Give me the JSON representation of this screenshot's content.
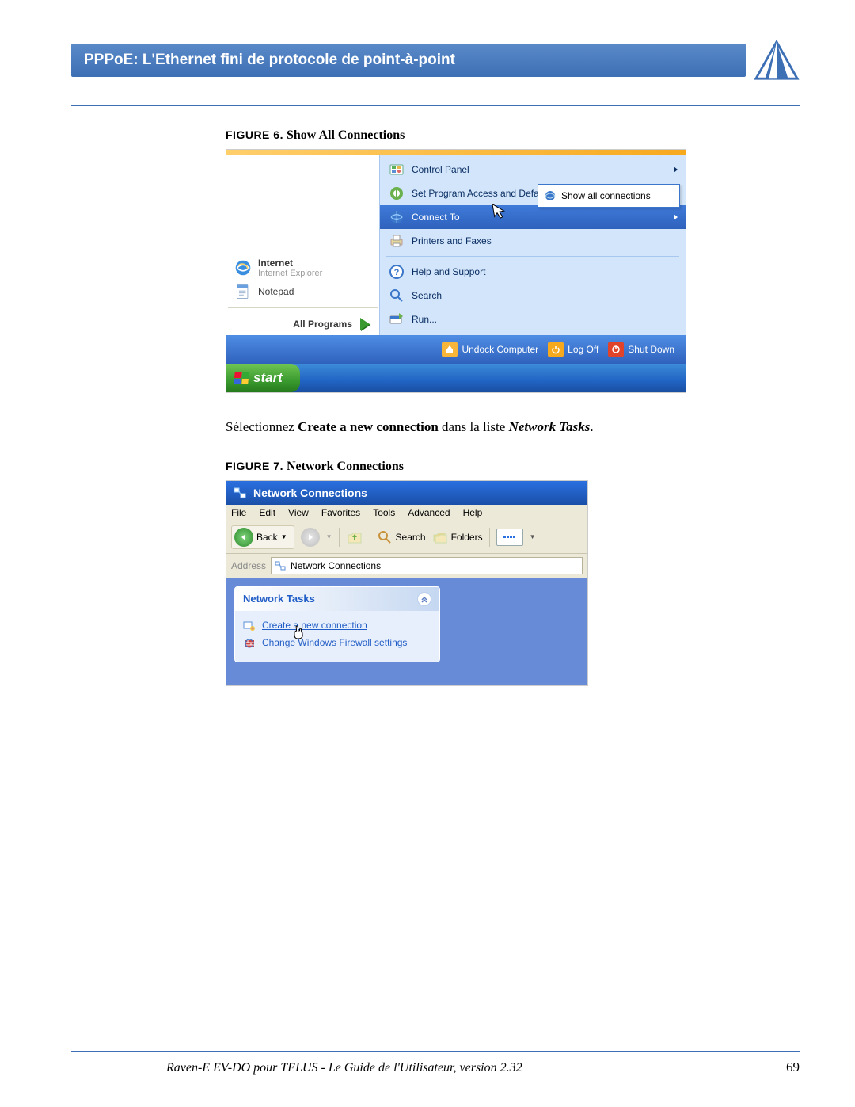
{
  "header": {
    "title": "PPPoE: L'Ethernet fini de protocole de point-à-point"
  },
  "fig6": {
    "label": "FIGURE 6.",
    "title": "Show All Connections",
    "left": {
      "internet_label": "Internet",
      "internet_sub": "Internet Explorer",
      "notepad": "Notepad",
      "all_programs": "All Programs"
    },
    "right": {
      "control_panel": "Control Panel",
      "set_program": "Set Program Access and Defaults",
      "connect_to": "Connect To",
      "printers": "Printers and Faxes",
      "help": "Help and Support",
      "search": "Search",
      "run": "Run..."
    },
    "flyout": {
      "show_all": "Show all connections"
    },
    "bottom": {
      "undock": "Undock Computer",
      "logoff": "Log Off",
      "shutdown": "Shut Down"
    },
    "start": "start"
  },
  "body": {
    "p1a": "Sélectionnez ",
    "p1b": "Create a new connection",
    "p1c": " dans la liste ",
    "p1d": "Network Tasks",
    "p1e": "."
  },
  "fig7": {
    "label": "FIGURE 7.",
    "title": "Network Connections",
    "window_title": "Network Connections",
    "menu": {
      "file": "File",
      "edit": "Edit",
      "view": "View",
      "favorites": "Favorites",
      "tools": "Tools",
      "advanced": "Advanced",
      "help": "Help"
    },
    "toolbar": {
      "back": "Back",
      "search": "Search",
      "folders": "Folders"
    },
    "address": {
      "label": "Address",
      "value": "Network Connections"
    },
    "tasks": {
      "header": "Network Tasks",
      "create": "Create a new connection",
      "firewall": "Change Windows Firewall settings"
    }
  },
  "footer": {
    "text": "Raven-E EV-DO pour TELUS - Le Guide de l'Utilisateur, version 2.32",
    "page": "69"
  }
}
